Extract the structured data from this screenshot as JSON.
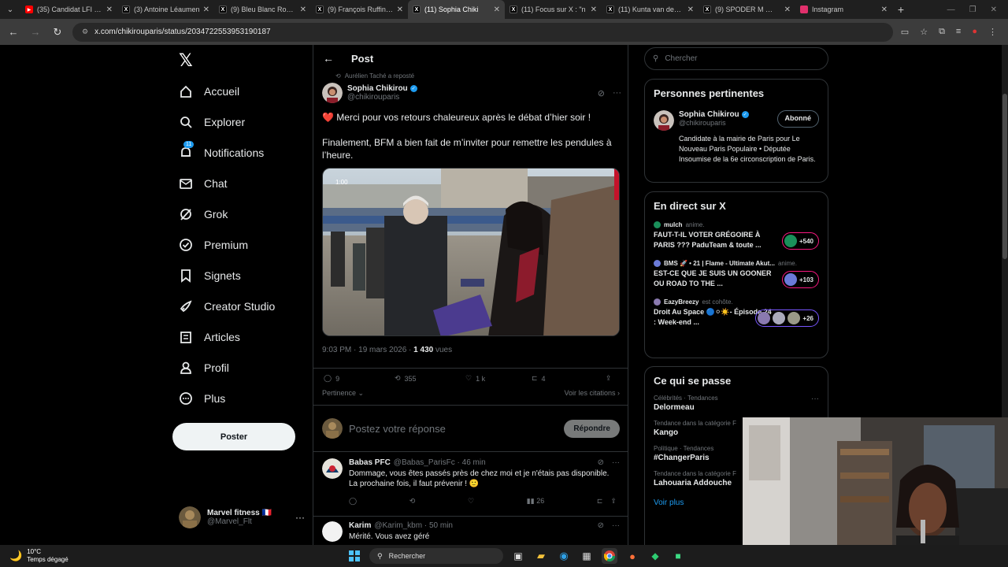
{
  "browser": {
    "tabs": [
      {
        "title": "(35) Candidat LFI ant",
        "icon": "youtube-icon",
        "color": "#ff0000"
      },
      {
        "title": "(3) Antoine Léaumen",
        "icon": "x-icon",
        "color": "#000000"
      },
      {
        "title": "(9) Bleu Blanc Rouge",
        "icon": "x-icon",
        "color": "#000000"
      },
      {
        "title": "(9) François Ruffin su",
        "icon": "x-icon",
        "color": "#000000"
      },
      {
        "title": "(11) Sophia Chiki",
        "icon": "x-icon",
        "color": "#000000",
        "active": true
      },
      {
        "title": "(11) Focus sur X : \"n",
        "icon": "x-icon",
        "color": "#000000"
      },
      {
        "title": "(11) Kunta van den K",
        "icon": "x-icon",
        "color": "#000000"
      },
      {
        "title": "(9) SPODER M 🕷 N s",
        "icon": "x-icon",
        "color": "#000000"
      },
      {
        "title": "Instagram",
        "icon": "instagram-icon",
        "color": "#e1306c"
      }
    ],
    "url": "x.com/chikirouparis/status/2034722553953190187"
  },
  "nav": {
    "items": [
      {
        "label": "Accueil",
        "icon": "home-icon"
      },
      {
        "label": "Explorer",
        "icon": "search-icon"
      },
      {
        "label": "Notifications",
        "icon": "bell-icon",
        "badge": "11"
      },
      {
        "label": "Chat",
        "icon": "mail-icon"
      },
      {
        "label": "Grok",
        "icon": "grok-icon"
      },
      {
        "label": "Premium",
        "icon": "premium-icon"
      },
      {
        "label": "Signets",
        "icon": "bookmark-icon"
      },
      {
        "label": "Creator Studio",
        "icon": "rocket-icon"
      },
      {
        "label": "Articles",
        "icon": "article-icon"
      },
      {
        "label": "Profil",
        "icon": "person-icon"
      },
      {
        "label": "Plus",
        "icon": "more-circle-icon"
      }
    ],
    "post_button": "Poster",
    "account": {
      "name": "Marvel fitness 🇫🇷",
      "handle": "@Marvel_Flt"
    }
  },
  "main": {
    "title": "Post",
    "repost_by": "Aurélien Taché a reposté",
    "author": {
      "name": "Sophia Chikirou",
      "handle": "@chikirouparis"
    },
    "text_1": "❤️ Merci pour vos retours chaleureux après le débat d’hier soir !",
    "text_2": "Finalement, BFM a bien fait de m’inviter pour remettre les pendules à l’heure.",
    "media_timestamp": "1:00",
    "time": "9:03 PM · 19 mars 2026 · ",
    "views_count": "1 430",
    "views_label": " vues",
    "stats": {
      "replies": "9",
      "reposts": "355",
      "likes": "1 k",
      "bookmarks": "4"
    },
    "sort_label": "Pertinence",
    "quotes_label": "Voir les citations",
    "reply_placeholder": "Postez votre réponse",
    "reply_button": "Répondre",
    "comments": [
      {
        "name": "Babas PFC",
        "handle": "@Babas_ParisFc · 46 min",
        "text": "Dommage, vous êtes passés près de chez moi et je n'étais pas disponible. La prochaine fois, il faut prévenir ! 🙂",
        "views": "26"
      },
      {
        "name": "Karim",
        "handle": "@Karim_kbm · 50 min",
        "text": "Mérité. Vous avez géré"
      }
    ]
  },
  "right": {
    "search_placeholder": "Chercher",
    "relevant": {
      "title": "Personnes pertinentes",
      "name": "Sophia Chikirou",
      "handle": "@chikirouparis",
      "follow": "Abonné",
      "bio": "Candidate à la mairie de Paris pour Le Nouveau Paris Populaire • Députée Insoumise de la 6e circonscription de Paris."
    },
    "live": {
      "title": "En direct sur X",
      "items": [
        {
          "host": "mulch",
          "sub": "anime.",
          "title": "FAUT-T-IL VOTER GRÉGOIRE À PARIS ??? PaduTeam & toute ...",
          "count": "+540"
        },
        {
          "host": "BMS 🚀 • 21 | Flame - Ultimate Akut...",
          "sub": "anime.",
          "title": "EST-CE QUE JE SUIS UN GOONER OU ROAD TO THE ...",
          "count": "+103"
        },
        {
          "host": "EazyBreezy",
          "sub": "est cohôte.",
          "title": "Droit Au Space 🔵⚪☀️- Épisode 24 : Week-end ...",
          "count": "+26"
        }
      ]
    },
    "trends": {
      "title": "Ce qui se passe",
      "items": [
        {
          "category": "Célébrités · Tendances",
          "name": "Delormeau"
        },
        {
          "category": "Tendance dans la catégorie F",
          "name": "Kango"
        },
        {
          "category": "Politique · Tendances",
          "name": "#ChangerParis"
        },
        {
          "category": "Tendance dans la catégorie F",
          "name": "Lahouaria Addouche"
        }
      ],
      "see_more": "Voir plus"
    }
  },
  "taskbar": {
    "temp": "10°C",
    "weather": "Temps dégagé",
    "search": "Rechercher"
  }
}
